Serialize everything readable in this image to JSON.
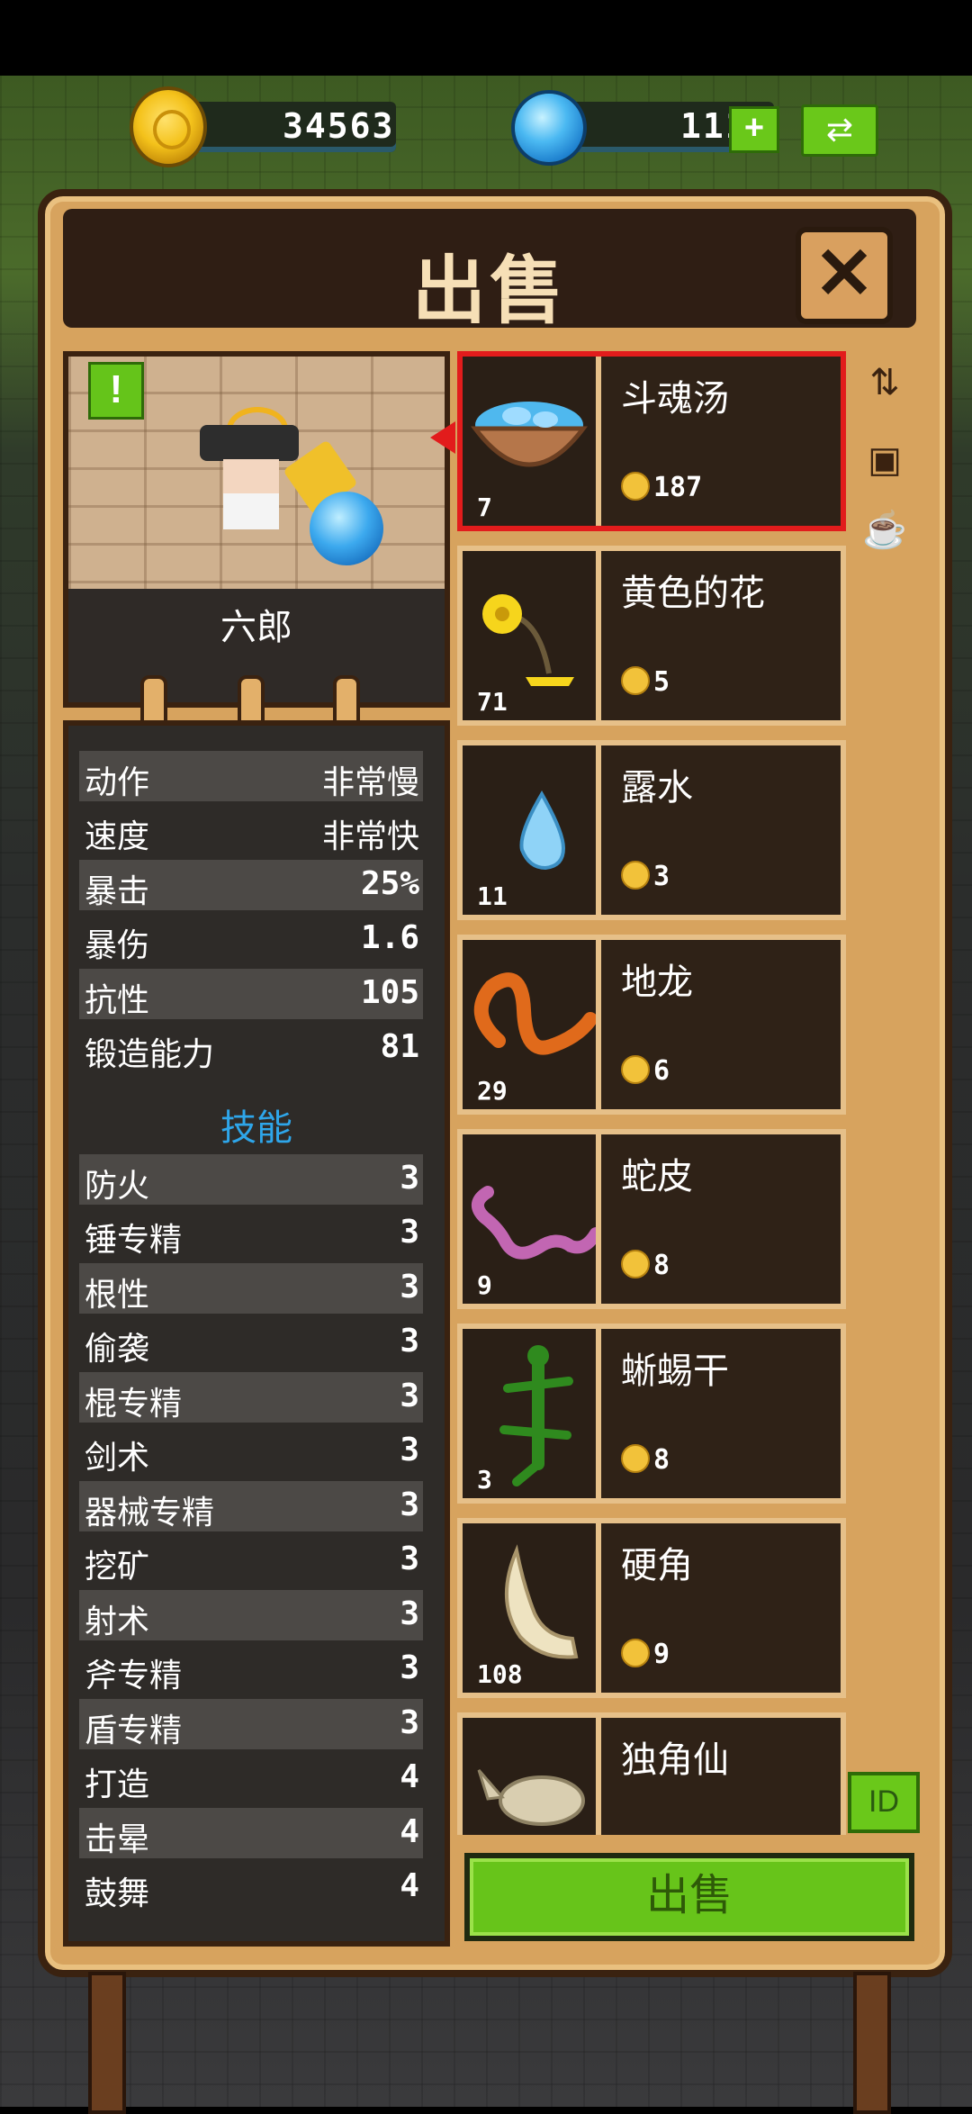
{
  "currency": {
    "gold": "34563",
    "gems": "111",
    "add_gems_label": "+",
    "swap_icon": "exchange-icon"
  },
  "dialog": {
    "title": "出售",
    "close_label": "✕"
  },
  "hero": {
    "name": "六郎",
    "alert_label": "!"
  },
  "stats": [
    {
      "label": "动作",
      "value": "非常慢"
    },
    {
      "label": "速度",
      "value": "非常快"
    },
    {
      "label": "暴击",
      "value": "25%"
    },
    {
      "label": "暴伤",
      "value": "1.6"
    },
    {
      "label": "抗性",
      "value": "105"
    },
    {
      "label": "锻造能力",
      "value": "81"
    }
  ],
  "skills_heading": "技能",
  "skills": [
    {
      "label": "防火",
      "value": "3"
    },
    {
      "label": "锤专精",
      "value": "3"
    },
    {
      "label": "根性",
      "value": "3"
    },
    {
      "label": "偷袭",
      "value": "3"
    },
    {
      "label": "棍专精",
      "value": "3"
    },
    {
      "label": "剑术",
      "value": "3"
    },
    {
      "label": "器械专精",
      "value": "3"
    },
    {
      "label": "挖矿",
      "value": "3"
    },
    {
      "label": "射术",
      "value": "3"
    },
    {
      "label": "斧专精",
      "value": "3"
    },
    {
      "label": "盾专精",
      "value": "3"
    },
    {
      "label": "打造",
      "value": "4"
    },
    {
      "label": "击晕",
      "value": "4"
    },
    {
      "label": "鼓舞",
      "value": "4"
    }
  ],
  "items": [
    {
      "name": "斗魂汤",
      "qty": "7",
      "price": "187",
      "icon": "soul-soup-icon",
      "selected": true
    },
    {
      "name": "黄色的花",
      "qty": "71",
      "price": "5",
      "icon": "yellow-flower-icon"
    },
    {
      "name": "露水",
      "qty": "11",
      "price": "3",
      "icon": "dew-drop-icon"
    },
    {
      "name": "地龙",
      "qty": "29",
      "price": "6",
      "icon": "earthworm-icon"
    },
    {
      "name": "蛇皮",
      "qty": "9",
      "price": "8",
      "icon": "snake-skin-icon"
    },
    {
      "name": "蜥蜴干",
      "qty": "3",
      "price": "8",
      "icon": "dried-lizard-icon"
    },
    {
      "name": "硬角",
      "qty": "108",
      "price": "9",
      "icon": "hard-horn-icon"
    },
    {
      "name": "独角仙",
      "qty": "",
      "price": "",
      "icon": "rhino-beetle-icon"
    }
  ],
  "side_icons": [
    "sort-icon",
    "chest-icon",
    "kettle-icon"
  ],
  "id_button_label": "ID",
  "sell_button_label": "出售",
  "colors": {
    "frame": "#d7a35e",
    "frame_border": "#3a2210",
    "panel": "#2f2217",
    "selected_border": "#e21c1c",
    "sell_button": "#67c41a",
    "skills_heading": "#2ea6ea"
  }
}
